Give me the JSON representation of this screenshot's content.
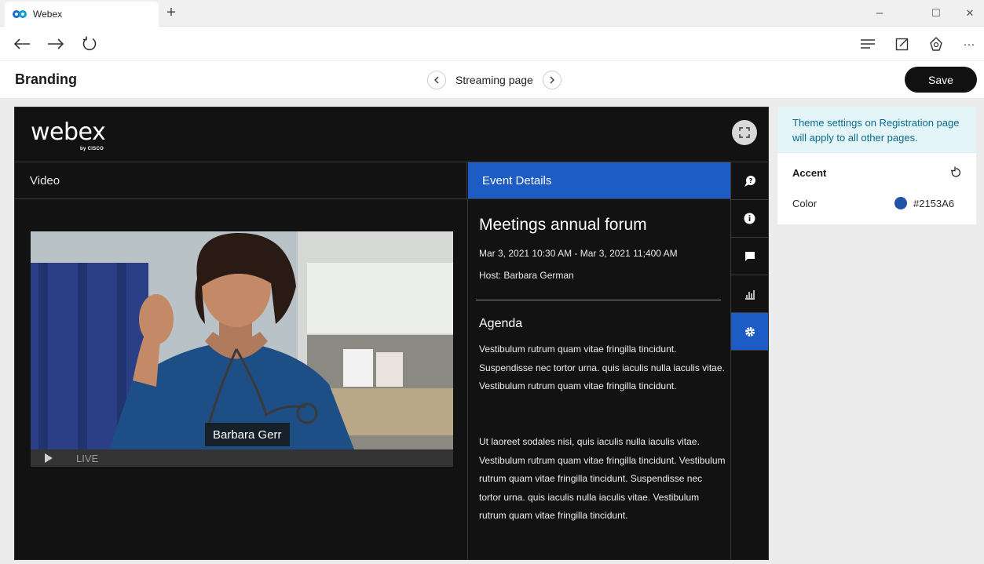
{
  "browser": {
    "tab_title": "Webex",
    "new_tab_symbol": "+",
    "window_controls": {
      "minimize": "–",
      "maximize": "☐",
      "close": "✕"
    },
    "more_symbol": "···"
  },
  "header": {
    "title": "Branding",
    "page_label": "Streaming page",
    "save_label": "Save"
  },
  "preview": {
    "logo_text": "webex",
    "logo_sub": "by CISCO",
    "video_tab": "Video",
    "event_tab": "Event Details",
    "video": {
      "live_label": "LIVE",
      "speaker_name": "Barbara Gerr"
    },
    "event": {
      "title": "Meetings annual forum",
      "datetime": "Mar 3, 2021 10:30 AM - Mar 3, 2021 11;400 AM",
      "host": "Host: Barbara German",
      "agenda_heading": "Agenda",
      "paragraph1": "Vestibulum rutrum quam vitae fringilla tincidunt. Suspendisse nec tortor urna. quis iaculis nulla iaculis vitae. Vestibulum rutrum quam vitae fringilla tincidunt.",
      "paragraph2": "Ut laoreet sodales nisi, quis iaculis nulla iaculis vitae. Vestibulum rutrum quam vitae fringilla tincidunt. Vestibulum rutrum quam vitae fringilla tincidunt. Suspendisse nec tortor urna. quis iaculis nulla iaculis vitae. Vestibulum rutrum quam vitae fringilla tincidunt."
    }
  },
  "panel": {
    "notice": "Theme settings on Registration page will apply to all other pages.",
    "accent_heading": "Accent",
    "color_label": "Color",
    "color_hex": "#2153A6"
  },
  "colors": {
    "accent": "#2153A6",
    "event_tab": "#1D5CC4",
    "save_button": "#111111",
    "notice_bg": "#E4F5FA"
  }
}
